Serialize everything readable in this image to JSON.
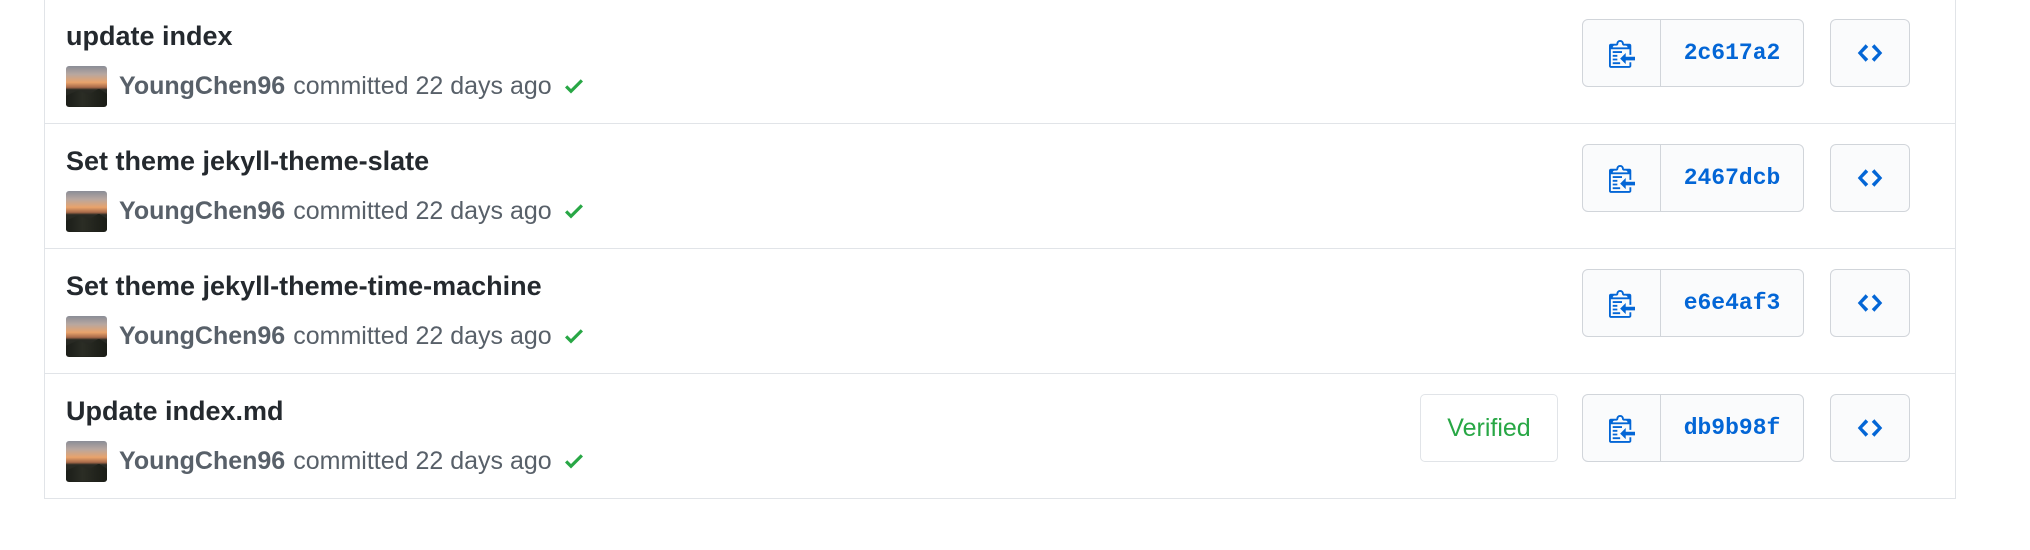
{
  "commits": [
    {
      "title": "update index",
      "author": "YoungChen96",
      "meta_text": "committed 22 days ago",
      "sha": "2c617a2",
      "verified": false
    },
    {
      "title": "Set theme jekyll-theme-slate",
      "author": "YoungChen96",
      "meta_text": "committed 22 days ago",
      "sha": "2467dcb",
      "verified": false
    },
    {
      "title": "Set theme jekyll-theme-time-machine",
      "author": "YoungChen96",
      "meta_text": "committed 22 days ago",
      "sha": "e6e4af3",
      "verified": false
    },
    {
      "title": "Update index.md",
      "author": "YoungChen96",
      "meta_text": "committed 22 days ago",
      "sha": "db9b98f",
      "verified": true,
      "verified_label": "Verified"
    }
  ],
  "icons": {
    "copy": "clippy-icon",
    "browse": "code-icon",
    "status": "check-icon"
  },
  "colors": {
    "link_blue": "#0366d6",
    "success_green": "#28a745",
    "title_text": "#24292e",
    "meta_text": "#586069",
    "border": "#e1e4e8"
  }
}
